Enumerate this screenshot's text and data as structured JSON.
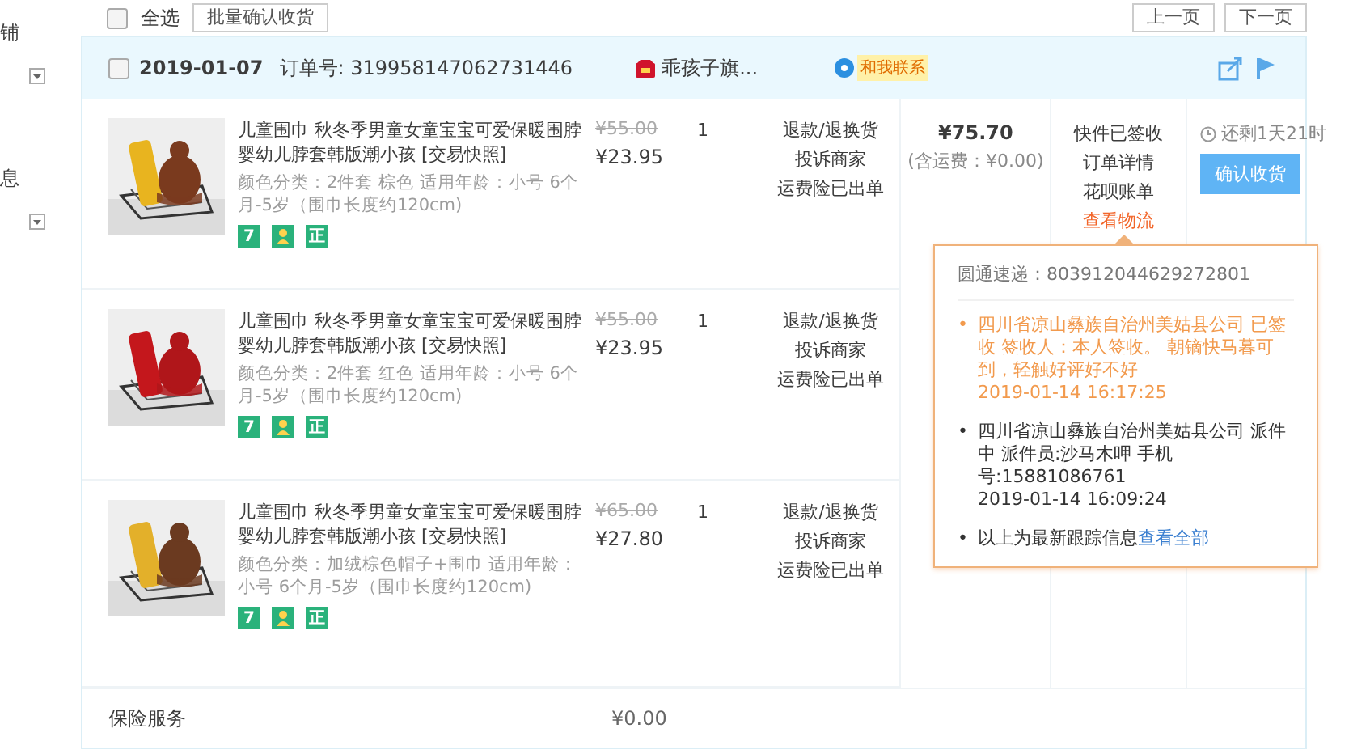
{
  "sidebar": {
    "items": [
      {
        "label": "铺"
      },
      {
        "label": "息"
      }
    ]
  },
  "toolbar": {
    "select_all": {
      "label": "全选",
      "checked": false
    },
    "bulk_button": "批量确认收货",
    "pager": [
      "上一页",
      "下一页"
    ]
  },
  "order": {
    "checked": false,
    "date": "2019-01-07",
    "order_no": "订单号: 319958147062731446",
    "store": "乖孩子旗...",
    "contact": "和我联系",
    "items": [
      {
        "title": "儿童围巾 秋冬季男童女童宝宝可爱保暖围脖婴幼儿脖套韩版潮小孩 [交易快照]",
        "spec": "颜色分类：2件套 棕色  适用年龄：小号 6个月-5岁（围巾长度约120cm)",
        "old_price": "¥55.00",
        "price": "¥23.95",
        "qty": "1",
        "actions": [
          "退款/退换货",
          "投诉商家",
          "运费险已出单"
        ],
        "badges": [
          {
            "kind": "text",
            "label": "7"
          },
          {
            "kind": "icon"
          },
          {
            "kind": "text",
            "label": "正"
          }
        ]
      },
      {
        "title": "儿童围巾 秋冬季男童女童宝宝可爱保暖围脖婴幼儿脖套韩版潮小孩 [交易快照]",
        "spec": "颜色分类：2件套 红色  适用年龄：小号 6个月-5岁（围巾长度约120cm)",
        "old_price": "¥55.00",
        "price": "¥23.95",
        "qty": "1",
        "actions": [
          "退款/退换货",
          "投诉商家",
          "运费险已出单"
        ],
        "badges": [
          {
            "kind": "text",
            "label": "7"
          },
          {
            "kind": "icon"
          },
          {
            "kind": "text",
            "label": "正"
          }
        ]
      },
      {
        "title": "儿童围巾 秋冬季男童女童宝宝可爱保暖围脖婴幼儿脖套韩版潮小孩 [交易快照]",
        "spec": "颜色分类：加绒棕色帽子+围巾  适用年龄：小号 6个月-5岁（围巾长度约120cm)",
        "old_price": "¥65.00",
        "price": "¥27.80",
        "qty": "1",
        "actions": [
          "退款/退换货",
          "投诉商家",
          "运费险已出单"
        ],
        "badges": [
          {
            "kind": "text",
            "label": "7"
          },
          {
            "kind": "icon"
          },
          {
            "kind": "text",
            "label": "正"
          }
        ]
      }
    ],
    "total": "¥75.70",
    "shipping": "(含运费：¥0.00)",
    "status": [
      {
        "label": "快件已签收",
        "kind": "text"
      },
      {
        "label": "订单详情",
        "kind": "link"
      },
      {
        "label": "花呗账单",
        "kind": "link"
      },
      {
        "label": "查看物流",
        "kind": "highlight"
      }
    ],
    "countdown": "还剩1天21时",
    "confirm_button": "确认收货",
    "insurance": {
      "label": "保险服务",
      "price": "¥0.00"
    }
  },
  "logistics": {
    "bullet": "•",
    "carrier": "圆通速递：803912044629272801",
    "entries": [
      {
        "text": "四川省凉山彝族自治州美姑县公司 已签收 签收人：本人签收。 朝镝快马暮可到，轻触好评好不好",
        "time": "2019-01-14 16:17:25",
        "latest": true
      },
      {
        "text": "四川省凉山彝族自治州美姑县公司 派件中 派件员:沙马木呷 手机号:15881086761",
        "time": "2019-01-14 16:09:24",
        "latest": false
      }
    ],
    "footer": "以上为最新跟踪信息",
    "footer_link": "查看全部"
  }
}
